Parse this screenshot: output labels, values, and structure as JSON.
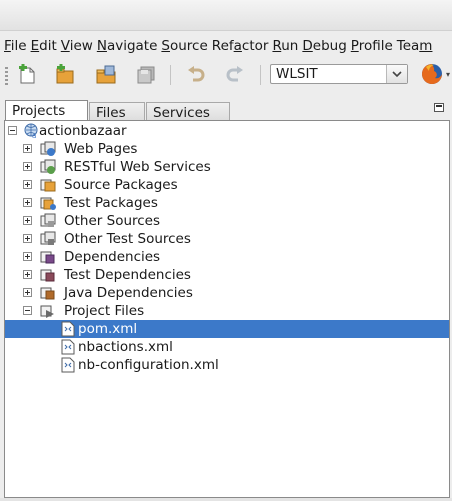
{
  "menubar": {
    "items": [
      {
        "mnemonic": "F",
        "rest": "ile"
      },
      {
        "mnemonic": "E",
        "rest": "dit"
      },
      {
        "mnemonic": "V",
        "rest": "iew"
      },
      {
        "mnemonic": "N",
        "rest": "avigate"
      },
      {
        "mnemonic": "S",
        "rest": "ource"
      },
      {
        "pre": "Ref",
        "mnemonic": "a",
        "rest": "ctor"
      },
      {
        "mnemonic": "R",
        "rest": "un"
      },
      {
        "mnemonic": "D",
        "rest": "ebug"
      },
      {
        "mnemonic": "P",
        "rest": "rofile"
      },
      {
        "pre": "Tea",
        "mnemonic": "m",
        "rest": ""
      }
    ]
  },
  "toolbar": {
    "config_value": "WLSIT",
    "icons": [
      "new-file-icon",
      "new-project-icon",
      "open-project-icon",
      "save-all-icon",
      "undo-icon",
      "redo-icon"
    ]
  },
  "tabs": [
    "Projects",
    "Files",
    "Services"
  ],
  "tree": {
    "root": "actionbazaar",
    "nodes": [
      {
        "label": "Web Pages",
        "icon": "web-pages-icon"
      },
      {
        "label": "RESTful Web Services",
        "icon": "rest-services-icon"
      },
      {
        "label": "Source Packages",
        "icon": "source-packages-icon"
      },
      {
        "label": "Test Packages",
        "icon": "test-packages-icon"
      },
      {
        "label": "Other Sources",
        "icon": "other-sources-icon"
      },
      {
        "label": "Other Test Sources",
        "icon": "other-test-sources-icon"
      },
      {
        "label": "Dependencies",
        "icon": "dependencies-icon"
      },
      {
        "label": "Test Dependencies",
        "icon": "test-dependencies-icon"
      },
      {
        "label": "Java Dependencies",
        "icon": "java-dependencies-icon"
      },
      {
        "label": "Project Files",
        "icon": "project-files-icon"
      }
    ],
    "files": [
      "pom.xml",
      "nbactions.xml",
      "nb-configuration.xml"
    ]
  },
  "colors": {
    "selection": "#3c79c9",
    "accent_green": "#4aa33b",
    "folder_orange": "#e7a23a"
  }
}
